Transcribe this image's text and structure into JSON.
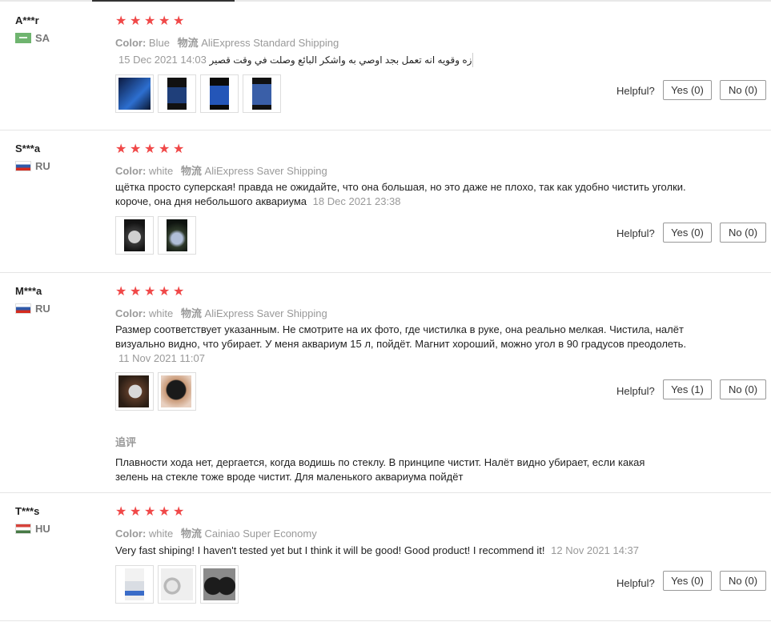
{
  "labels": {
    "color_label": "Color:",
    "shipping_label": "物流",
    "helpful": "Helpful?",
    "followup_label": "追评"
  },
  "reviews": [
    {
      "user": "A***r",
      "country": "SA",
      "rating": 5,
      "color": "Blue",
      "shipping": "AliExpress Standard Shipping",
      "text": "نوعيه ممتازه وقويه انه تعمل بجد اوصي به واشكر البائع وصلت في وقت قصير",
      "date": "15 Dec 2021 14:03",
      "photos": 4,
      "yes": "Yes (0)",
      "no": "No (0)"
    },
    {
      "user": "S***a",
      "country": "RU",
      "rating": 5,
      "color": "white",
      "shipping": "AliExpress Saver Shipping",
      "text": "щётка просто суперская! правда не ожидайте, что она большая, но это даже не плохо, так как удобно чистить уголки. короче, она дня небольшого аквариума",
      "date": "18 Dec 2021 23:38",
      "photos": 2,
      "yes": "Yes (0)",
      "no": "No (0)"
    },
    {
      "user": "M***a",
      "country": "RU",
      "rating": 5,
      "color": "white",
      "shipping": "AliExpress Saver Shipping",
      "text": "Размер соответствует указанным. Не смотрите на их фото, где чистилка в руке, она реально мелкая. Чистила, налёт визуально видно, что убирает. У меня аквариум 15 л, пойдёт. Магнит хороший, можно угол в 90 градусов преодолеть.",
      "date": "11 Nov 2021 11:07",
      "photos": 2,
      "yes": "Yes (1)",
      "no": "No (0)",
      "followup": "Плавности хода нет, дергается, когда водишь по стеклу. В принципе чистит. Налёт видно убирает, если какая зелень на стекле тоже вроде чистит. Для маленького аквариума пойдёт"
    },
    {
      "user": "T***s",
      "country": "HU",
      "rating": 5,
      "color": "white",
      "shipping": "Cainiao Super Economy",
      "text": "Very fast shiping! I haven't tested yet but I think it will be good! Good product! I recommend it!",
      "date": "12 Nov 2021 14:37",
      "photos": 3,
      "yes": "Yes (0)",
      "no": "No (0)"
    }
  ],
  "colors": {
    "star": "#f04848",
    "muted": "#999999",
    "text": "#222222"
  }
}
